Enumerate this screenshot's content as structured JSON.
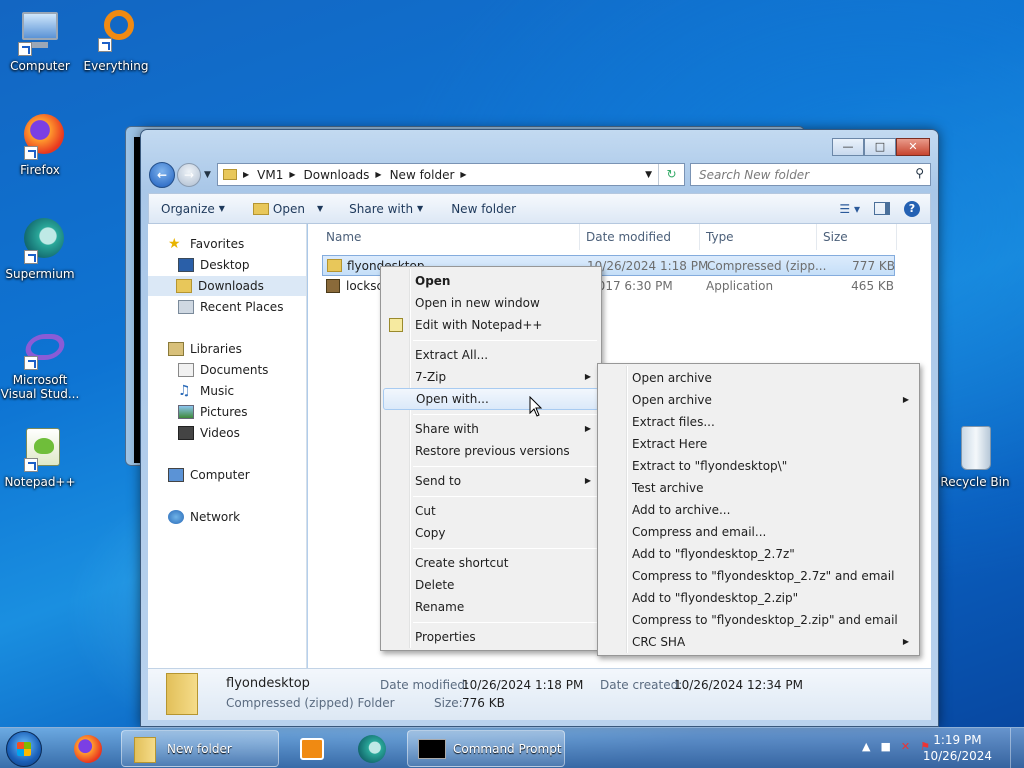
{
  "desktop": {
    "icons": [
      {
        "label": "Computer"
      },
      {
        "label": "Everything"
      },
      {
        "label": "Firefox"
      },
      {
        "label": "Supermium"
      },
      {
        "label": "Microsoft Visual Stud..."
      },
      {
        "label": "Notepad++"
      },
      {
        "label": "Recycle Bin"
      }
    ]
  },
  "explorer": {
    "breadcrumb": [
      "VM1",
      "Downloads",
      "New folder"
    ],
    "search_placeholder": "Search New folder",
    "toolbar": {
      "organize": "Organize",
      "open": "Open",
      "share_with": "Share with",
      "new_folder": "New folder"
    },
    "nav": {
      "favorites": "Favorites",
      "desktop": "Desktop",
      "downloads": "Downloads",
      "recent": "Recent Places",
      "libraries": "Libraries",
      "documents": "Documents",
      "music": "Music",
      "pictures": "Pictures",
      "videos": "Videos",
      "computer": "Computer",
      "network": "Network"
    },
    "columns": {
      "name": "Name",
      "date": "Date modified",
      "type": "Type",
      "size": "Size"
    },
    "files": [
      {
        "name": "flyondesktop",
        "date": "10/26/2024 1:18 PM",
        "type": "Compressed (zipp...",
        "size": "777 KB"
      },
      {
        "name": "locksc",
        "date": "/2017 6:30 PM",
        "type": "Application",
        "size": "465 KB"
      }
    ],
    "details": {
      "name": "flyondesktop",
      "kind": "Compressed (zipped) Folder",
      "date_modified_label": "Date modified:",
      "date_modified": "10/26/2024 1:18 PM",
      "size_label": "Size:",
      "size": "776 KB",
      "date_created_label": "Date created:",
      "date_created": "10/26/2024 12:34 PM"
    }
  },
  "context_menu": {
    "items": [
      "Open",
      "Open in new window",
      "Edit with Notepad++",
      "Extract All...",
      "7-Zip",
      "Open with...",
      "Share with",
      "Restore previous versions",
      "Send to",
      "Cut",
      "Copy",
      "Create shortcut",
      "Delete",
      "Rename",
      "Properties"
    ]
  },
  "zip_menu": {
    "items": [
      "Open archive",
      "Open archive",
      "Extract files...",
      "Extract Here",
      "Extract to \"flyondesktop\\\"",
      "Test archive",
      "Add to archive...",
      "Compress and email...",
      "Add to \"flyondesktop_2.7z\"",
      "Compress to \"flyondesktop_2.7z\" and email",
      "Add to \"flyondesktop_2.zip\"",
      "Compress to \"flyondesktop_2.zip\" and email",
      "CRC SHA"
    ]
  },
  "taskbar": {
    "new_folder": "New folder",
    "command_prompt": "Command Prompt",
    "time": "1:19 PM",
    "date": "10/26/2024"
  }
}
